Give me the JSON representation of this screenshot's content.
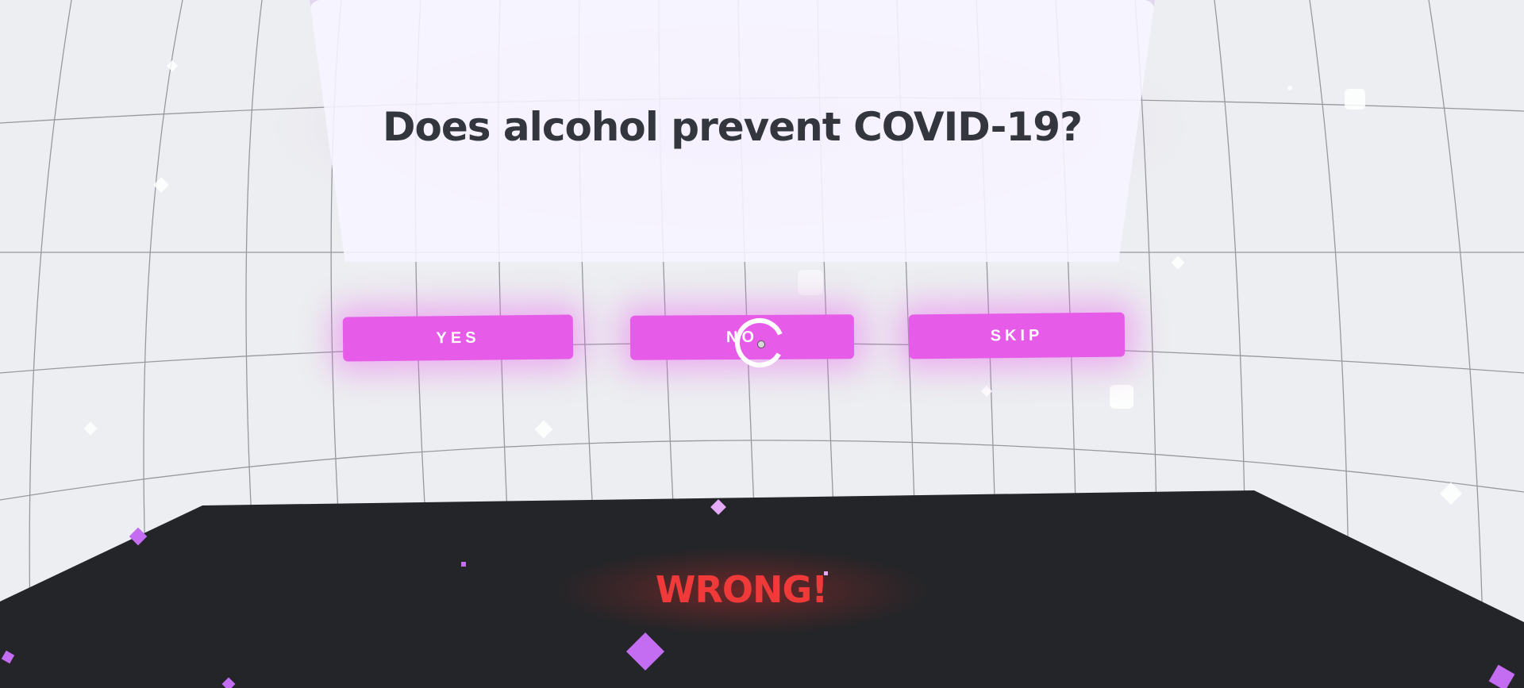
{
  "question": {
    "text": "Does alcohol prevent COVID-19?"
  },
  "answers": {
    "yes": "YES",
    "no": "NO",
    "skip": "SKIP"
  },
  "result": {
    "text": "WRONG!"
  },
  "colors": {
    "button": "#e65ce9",
    "wrong": "#f03a3a",
    "floor": "#232528",
    "particle": "#c46cf2"
  },
  "icons": {
    "cursor": "gaze-reticle-icon",
    "particle": "diamond-icon"
  }
}
